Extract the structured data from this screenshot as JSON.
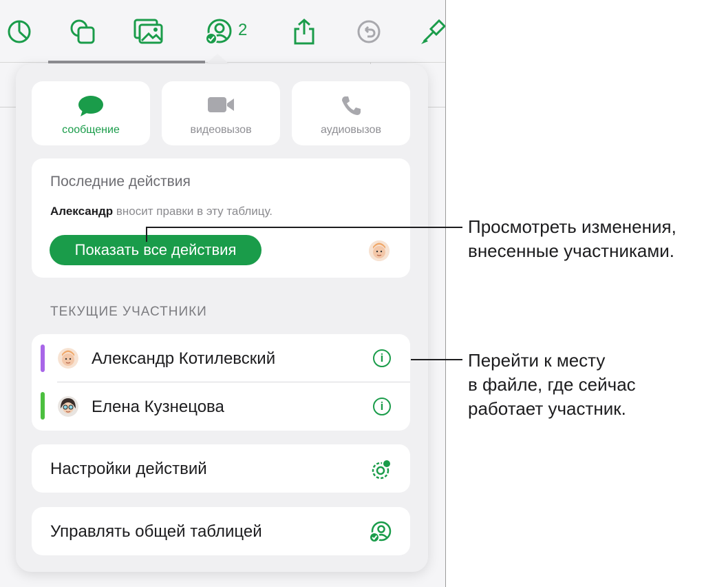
{
  "toolbar": {
    "icons": [
      "chart-icon",
      "shapes-icon",
      "media-icon",
      "collaboration-icon",
      "share-icon",
      "undo-icon",
      "format-brush-icon"
    ],
    "collaborators_count": "2"
  },
  "communication": {
    "message": "сообщение",
    "video": "видеовызов",
    "audio": "аудиовызов"
  },
  "activity": {
    "title": "Последние действия",
    "author": "Александр",
    "text": "вносит правки в эту таблицу.",
    "button": "Показать все действия"
  },
  "participants": {
    "heading": "ТЕКУЩИЕ УЧАСТНИКИ",
    "items": [
      {
        "name": "Александр Котилевский",
        "color": "#a866e8"
      },
      {
        "name": "Елена Кузнецова",
        "color": "#4cbf3f"
      }
    ]
  },
  "settings": {
    "activity_settings": "Настройки действий",
    "manage_sheet": "Управлять общей таблицей"
  },
  "callouts": {
    "first": [
      "Просмотреть изменения,",
      "внесенные участниками."
    ],
    "second": [
      "Перейти к месту",
      "в файле, где сейчас",
      "работает участник."
    ]
  },
  "colors": {
    "accent": "#1a9c4a"
  }
}
